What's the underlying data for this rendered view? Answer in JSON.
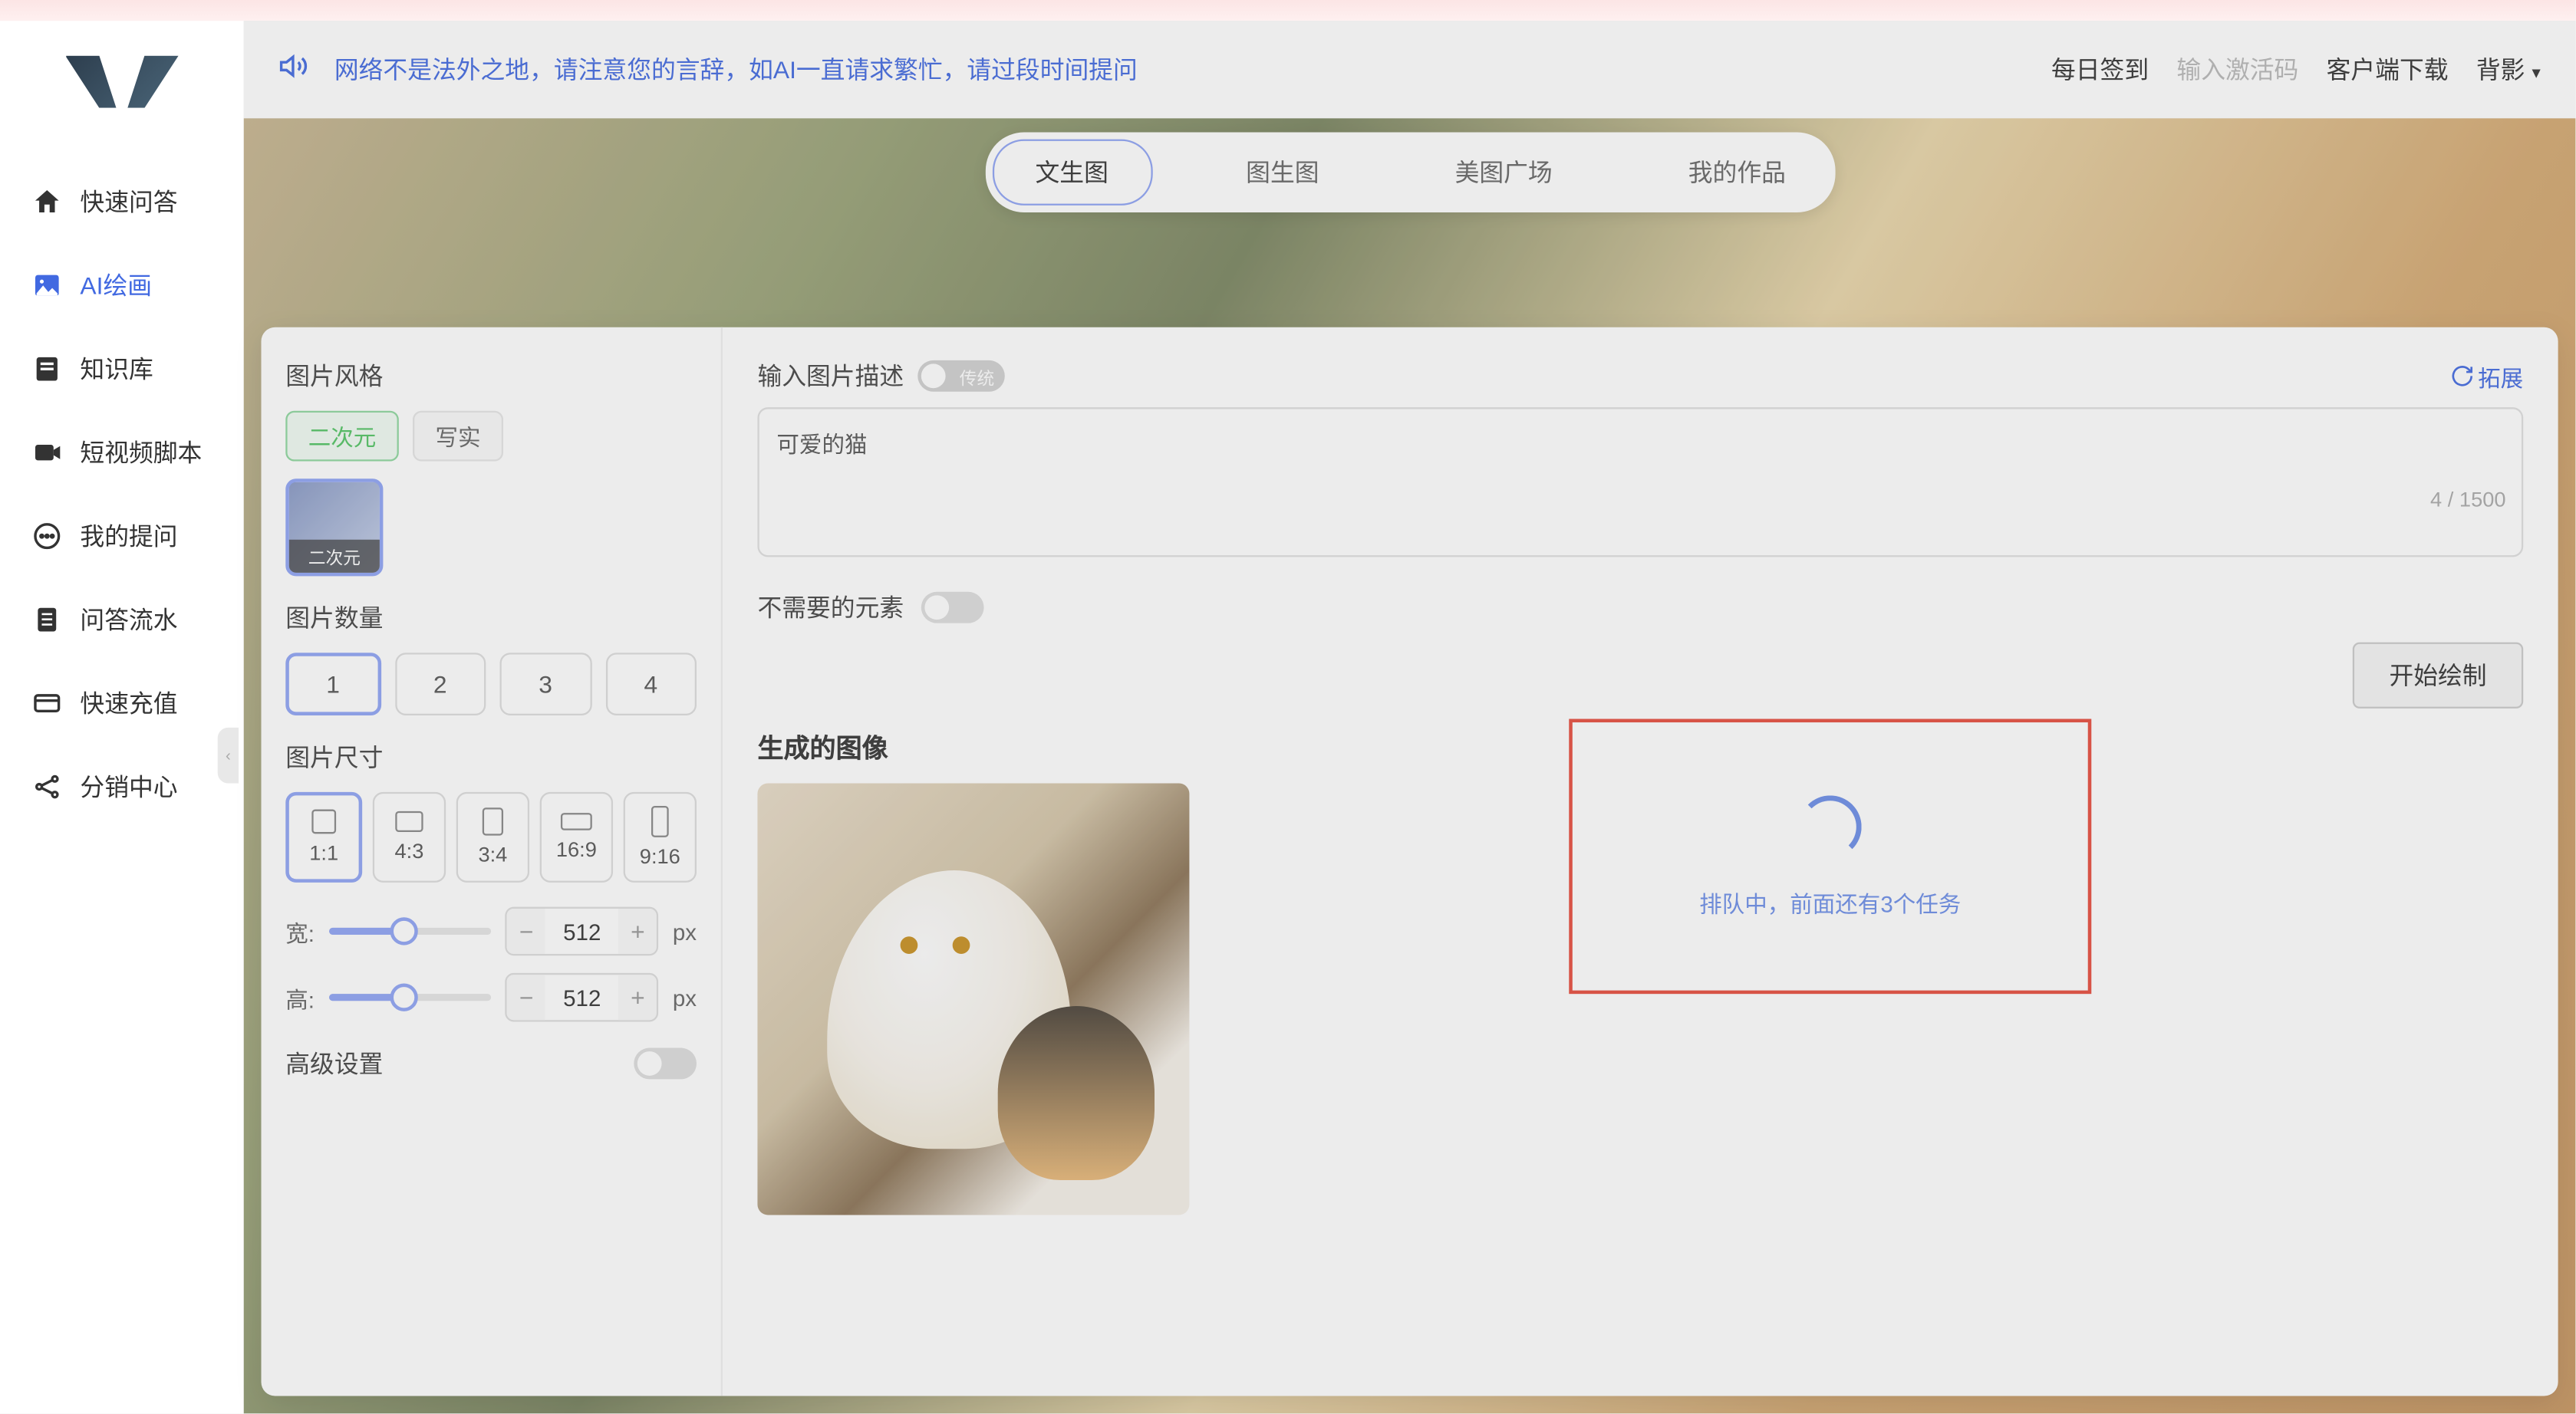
{
  "header": {
    "notice": "网络不是法外之地，请注意您的言辞，如AI一直请求繁忙，请过段时间提问",
    "checkin": "每日签到",
    "activate": "输入激活码",
    "download": "客户端下载",
    "theme": "背影"
  },
  "sidebar": {
    "items": [
      {
        "label": "快速问答",
        "icon": "home"
      },
      {
        "label": "AI绘画",
        "icon": "image",
        "active": true
      },
      {
        "label": "知识库",
        "icon": "book"
      },
      {
        "label": "短视频脚本",
        "icon": "video"
      },
      {
        "label": "我的提问",
        "icon": "chat"
      },
      {
        "label": "问答流水",
        "icon": "list"
      },
      {
        "label": "快速充值",
        "icon": "card"
      },
      {
        "label": "分销中心",
        "icon": "share"
      }
    ]
  },
  "tabs": {
    "items": [
      "文生图",
      "图生图",
      "美图广场",
      "我的作品"
    ],
    "active": 0
  },
  "left_panel": {
    "style_label": "图片风格",
    "style_chips": [
      "二次元",
      "写实"
    ],
    "style_chip_active": 0,
    "style_thumb_label": "二次元",
    "count_label": "图片数量",
    "counts": [
      "1",
      "2",
      "3",
      "4"
    ],
    "count_active": 0,
    "size_label": "图片尺寸",
    "ratios": [
      "1:1",
      "4:3",
      "3:4",
      "16:9",
      "9:16"
    ],
    "ratio_active": 0,
    "width_label": "宽:",
    "height_label": "高:",
    "width_value": "512",
    "height_value": "512",
    "unit": "px",
    "advanced": "高级设置"
  },
  "right_panel": {
    "prompt_label": "输入图片描述",
    "badge_text": "传统",
    "expand": "拓展",
    "prompt_value": "可爱的猫",
    "char_current": "4",
    "char_max": "1500",
    "negative_label": "不需要的元素",
    "generate_btn": "开始绘制",
    "output_label": "生成的图像"
  },
  "queue": {
    "text": "排队中，前面还有3个任务"
  }
}
